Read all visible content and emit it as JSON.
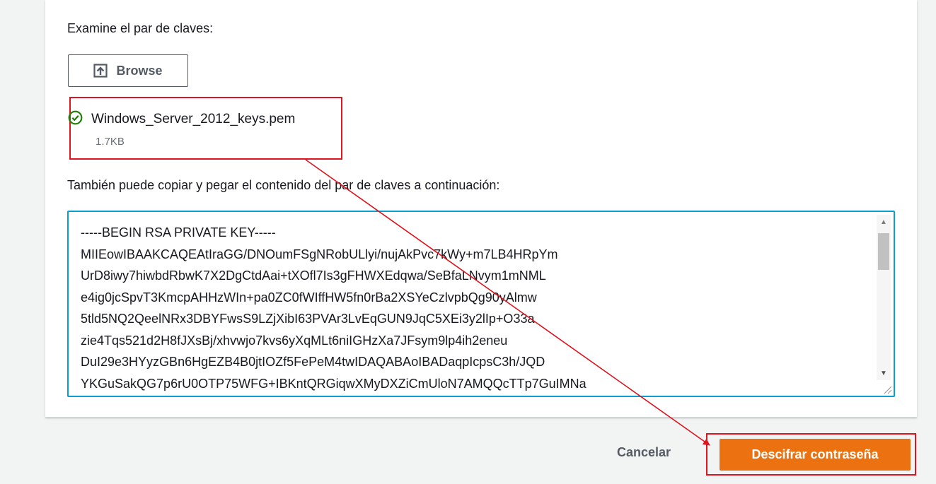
{
  "form": {
    "examine_label": "Examine el par de claves:",
    "browse_label": "Browse",
    "file_name": "Windows_Server_2012_keys.pem",
    "file_size": "1.7KB",
    "paste_label": "También puede copiar y pegar el contenido del par de claves a continuación:",
    "key_text": "-----BEGIN RSA PRIVATE KEY-----\nMIIEowIBAAKCAQEAtIraGG/DNOumFSgNRobULlyi/nujAkPvc7kWy+m7LB4HRpYm\nUrD8iwy7hiwbdRbwK7X2DgCtdAai+tXOfl7Is3gFHWXEdqwa/SeBfaLNvym1mNML\ne4ig0jcSpvT3KmcpAHHzWIn+pa0ZC0fWIffHW5fn0rBa2XSYeCzlvpbQg90yAlmw\n5tld5NQ2QeelNRx3DBYFwsS9LZjXibI63PVAr3LvEqGUN9JqC5XEi3y2lIp+O33a\nzie4Tqs521d2H8fJXsBj/xhvwjo7kvs6yXqMLt6niIGHzXa7JFsym9lp4ih2eneu\nDuI29e3HYyzGBn6HgEZB4B0jtIOZf5FePeM4twIDAQABAoIBADaqpIcpsC3h/JQD\nYKGuSakQG7p6rU0OTP75WFG+IBKntQRGiqwXMyDXZiCmUloN7AMQQcTTp7GuIMNa"
  },
  "actions": {
    "cancel_label": "Cancelar",
    "decrypt_label": "Descifrar contraseña"
  },
  "colors": {
    "accent_orange": "#ec7211",
    "annotation_red": "#e0141e",
    "focus_blue": "#0a9fd0",
    "success_green": "#1d8102"
  },
  "icons": {
    "browse": "upload-icon",
    "status": "check-circle-icon"
  }
}
